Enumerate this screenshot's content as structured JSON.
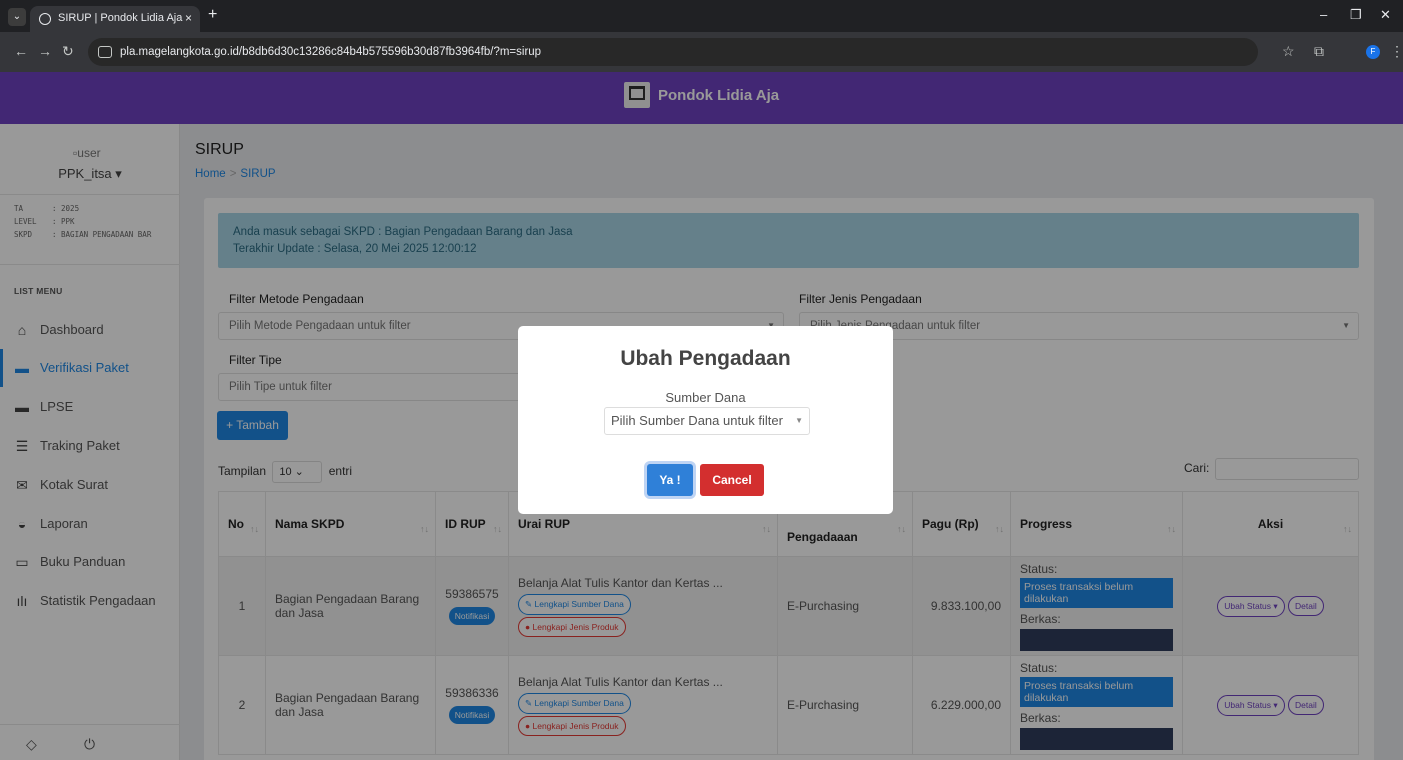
{
  "browser": {
    "tab_title": "SIRUP | Pondok Lidia Aja",
    "tab_close": "×",
    "new_tab": "+",
    "url": "pla.magelangkota.go.id/b8db6d30c13286c84b4b575596b30d87fb3964fb/?m=sirup",
    "profile_initial": "F"
  },
  "app": {
    "brand": "Pondok Lidia Aja"
  },
  "sidebar": {
    "user_img_alt": "user",
    "user_name": "PPK_itsa ▾",
    "info": [
      {
        "key": "TA",
        "value": ": 2025"
      },
      {
        "key": "LEVEL",
        "value": ": PPK"
      },
      {
        "key": "SKPD",
        "value": ": BAGIAN PENGADAAN BAR"
      }
    ],
    "list_menu": "LIST MENU",
    "items": [
      {
        "label": "Dashboard",
        "icon": "home-icon"
      },
      {
        "label": "Verifikasi Paket",
        "icon": "archive-icon"
      },
      {
        "label": "LPSE",
        "icon": "archive-icon"
      },
      {
        "label": "Traking Paket",
        "icon": "list-icon"
      },
      {
        "label": "Kotak Surat",
        "icon": "envelope-icon"
      },
      {
        "label": "Laporan",
        "icon": "hdd-icon"
      },
      {
        "label": "Buku Panduan",
        "icon": "book-icon"
      },
      {
        "label": "Statistik Pengadaan",
        "icon": "chart-icon"
      }
    ]
  },
  "page": {
    "title": "SIRUP",
    "breadcrumb_home": "Home",
    "breadcrumb_sep": ">",
    "breadcrumb_current": "SIRUP"
  },
  "alert": {
    "line1": "Anda masuk sebagai SKPD : Bagian Pengadaan Barang dan Jasa",
    "line2": "Terakhir Update : Selasa, 20 Mei 2025 12:00:12"
  },
  "filters": {
    "metode_label": "Filter Metode Pengadaan",
    "metode_placeholder": "Pilih Metode Pengadaan untuk filter",
    "jenis_label": "Filter Jenis Pengadaan",
    "jenis_placeholder": "Pilih Jenis Pengadaan untuk filter",
    "tipe_label": "Filter Tipe",
    "tipe_placeholder": "Pilih Tipe untuk filter"
  },
  "toolbar": {
    "tambah": "+ Tambah",
    "tampilan_prefix": "Tampilan",
    "tampilan_value": "10",
    "tampilan_suffix": "entri",
    "cari": "Cari:"
  },
  "table": {
    "headers": [
      "No",
      "Nama SKPD",
      "ID RUP",
      "Urai RUP",
      "Pengadaaan",
      "Pagu (Rp)",
      "Progress",
      "Aksi"
    ],
    "rows": [
      {
        "no": "1",
        "skpd": "Bagian Pengadaan Barang dan Jasa",
        "id_rup": "59386575",
        "notif": "Notifikasi",
        "urai": "Belanja Alat Tulis Kantor dan Kertas ...",
        "btn_sumber": "Lengkapi Sumber Dana",
        "btn_jenis": "Lengkapi Jenis Produk",
        "pengadaan": "E-Purchasing",
        "pagu": "9.833.100,00",
        "status_label": "Status:",
        "status_value": "Proses transaksi belum dilakukan",
        "berkas_label": "Berkas:",
        "aksi_status": "Ubah Status ▾",
        "aksi_detail": "Detail"
      },
      {
        "no": "2",
        "skpd": "Bagian Pengadaan Barang dan Jasa",
        "id_rup": "59386336",
        "notif": "Notifikasi",
        "urai": "Belanja Alat Tulis Kantor dan Kertas ...",
        "btn_sumber": "Lengkapi Sumber Dana",
        "btn_jenis": "Lengkapi Jenis Produk",
        "pengadaan": "E-Purchasing",
        "pagu": "6.229.000,00",
        "status_label": "Status:",
        "status_value": "Proses transaksi belum dilakukan",
        "berkas_label": "Berkas:",
        "aksi_status": "Ubah Status ▾",
        "aksi_detail": "Detail"
      }
    ]
  },
  "modal": {
    "title": "Ubah Pengadaan",
    "label": "Sumber Dana",
    "select_placeholder": "Pilih Sumber Dana untuk filter",
    "confirm": "Ya !",
    "cancel": "Cancel"
  },
  "colors": {
    "header_purple": "#6f42c1",
    "primary_blue": "#1e88e5",
    "danger_red": "#d32f2f",
    "alert_bg": "#a9d5e6"
  }
}
